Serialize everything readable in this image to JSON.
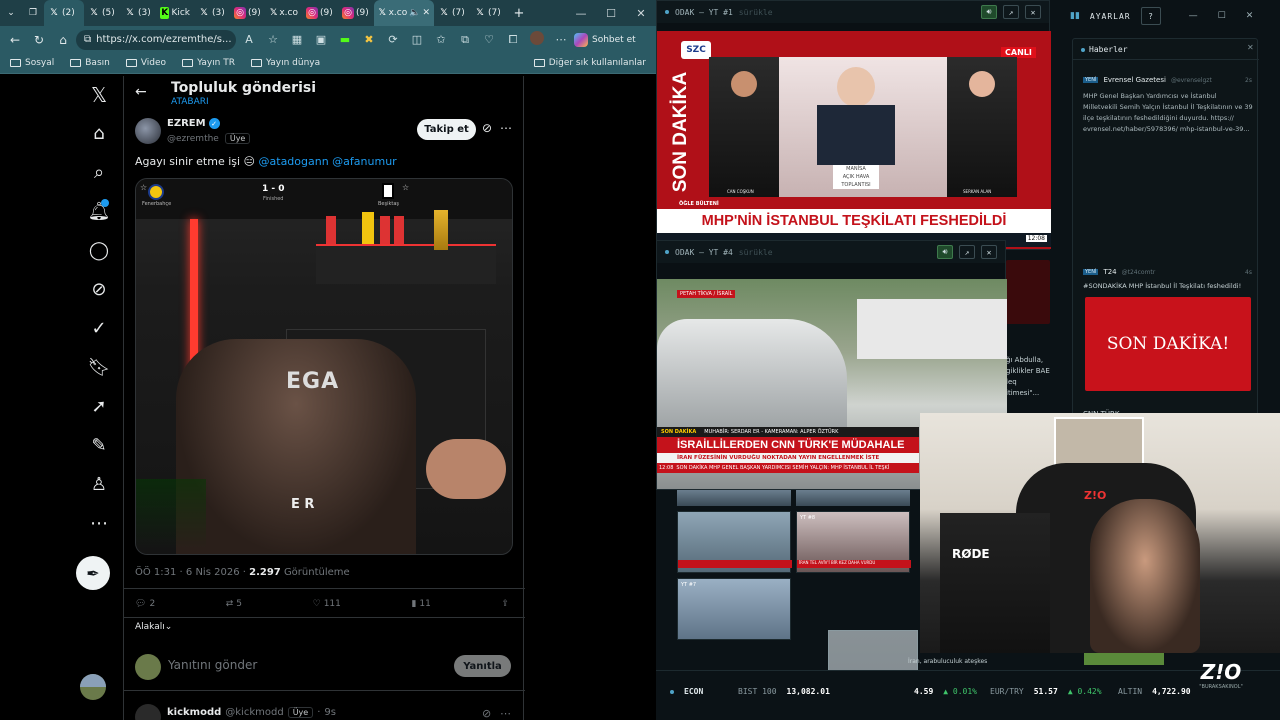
{
  "browser": {
    "tabs": [
      {
        "icon": "x",
        "label": "(2)"
      },
      {
        "icon": "x",
        "label": "(5)"
      },
      {
        "icon": "x",
        "label": "(3)"
      },
      {
        "icon": "kick",
        "label": "Kick"
      },
      {
        "icon": "x",
        "label": "(3)"
      },
      {
        "icon": "ig",
        "label": "(9)"
      },
      {
        "icon": "x",
        "label": "x.co"
      },
      {
        "icon": "ig",
        "label": "(9)"
      },
      {
        "icon": "ig",
        "label": "(9)"
      },
      {
        "icon": "x",
        "label": "x.co"
      },
      {
        "icon": "x",
        "label": "(7)"
      },
      {
        "icon": "x",
        "label": "(7)"
      }
    ],
    "url": "https://x.com/ezremthe/s...",
    "copilot_label": "Sohbet et",
    "bookmarks": [
      "Sosyal",
      "Basın",
      "Video",
      "Yayın TR",
      "Yayın dünya"
    ],
    "bookmarks_right": "Diğer sık kullanılanlar"
  },
  "x": {
    "page_title": "Topluluk gönderisi",
    "page_sub": "ATABARI",
    "author_name": "EZREM",
    "author_handle": "@ezremthe",
    "author_badge": "Üye",
    "follow_label": "Takip et",
    "tweet_text": "Agayı sinir etme işi 😑",
    "mentions": "@atadogann @afanumur",
    "time": "ÖÖ 1:31 · 6 Nis 2026 ·",
    "views_count": "2.297",
    "views_label": "Görüntüleme",
    "replies": "2",
    "reposts": "5",
    "likes": "111",
    "bookmarks": "11",
    "sort_label": "Alakalı",
    "reply_placeholder": "Yanıtını gönder",
    "reply_button": "Yanıtla",
    "next_reply_name": "kickmodd",
    "next_reply_handle": "@kickmodd",
    "next_reply_badge": "Üye",
    "next_reply_time": "9s",
    "media": {
      "score": "1 - 0",
      "score_sub": "Finished",
      "team1": "Fenerbahçe",
      "team2": "Beşiktaş",
      "shirt_text": "EGA",
      "logo_text": "E R"
    }
  },
  "dash": {
    "settings_label": "AYARLAR",
    "help_label": "?",
    "video1": {
      "title": "ODAK — YT #1",
      "sub": "sürükle",
      "channel": "SZC",
      "live": "CANLI",
      "banner_top": "SON DAKİKA",
      "bulletin": "ÖĞLE BÜLTENİ",
      "headline": "MHP'NİN İSTANBUL TEŞKİLATI FESHEDİLDİ",
      "time": "12:08",
      "name1": "CAN COŞKUN",
      "name2": "SERKAN ALAN",
      "podium": "MANİSA",
      "podium_sub": "AÇIK HAVA TOPLANTISI"
    },
    "video2": {
      "title": "ODAK — YT #4",
      "sub": "sürükle",
      "location": "PETAH TİKVA / İSRAİL",
      "tag": "SON DAKİKA",
      "credits": "MUHABİR: SERDAR ER - KAMERAMAN: ALPER ÖZTÜRK",
      "headline": "İSRAİLLİLERDEN CNN TÜRK'E MÜDAHALE",
      "sub_headline": "İRAN FÜZESİNİN VURDUĞU NOKTADAN YAYIN ENGELLENMEK İSTE",
      "ticker": "SON DAKİKA  MHP GENEL BAŞKAN YARDIMCISI SEMİH YALÇIN: MHP İSTANBUL İL TEŞKİ",
      "ticker_time": "12:08"
    },
    "thumbs": [
      {
        "label": "",
        "caption": ""
      },
      {
        "label": "YT #8",
        "caption": "İRAN TEL AVİV'İ BİR KEZ DAHA VURDU"
      },
      {
        "label": "YT #7",
        "caption": ""
      }
    ],
    "behind_text": [
      "ğı Abdulla,",
      "giklikler BAE",
      "leq",
      "itimesi\"..."
    ],
    "behind_caption": "İran, arabuluculuk ateşkes",
    "news_panel": {
      "title": "Haberler",
      "item1": {
        "badge": "YENİ",
        "source": "Evrensel Gazetesi",
        "handle": "@evrenselgzt",
        "age": "2s",
        "text": "MHP Genel Başkan Yardımcısı ve İstanbul Milletvekili Semih Yalçın İstanbul İl Teşkilatının ve 39 ilçe teşkilatının feshedildiğini duyurdu. https:// evrensel.net/haber/5978396/ mhp-istanbul-ve-39..."
      },
      "item2": {
        "badge": "YENİ",
        "source": "T24",
        "handle": "@t24comtr",
        "age": "4s",
        "text": "#SONDAKİKA MHP İstanbul İl Teşkilatı feshedildi!",
        "card": "SON DAKİKA!"
      },
      "item3": {
        "source": "CNN TÜRK"
      }
    },
    "ticker": {
      "econ": "ECON",
      "bist_label": "BIST 100",
      "bist": "13,082.01",
      "usd_value": "4.59",
      "usd_change": "▲ 0.01%",
      "eur_label": "EUR/TRY",
      "eur": "51.57",
      "eur_change": "▲ 0.42%",
      "gold_label": "ALTIN",
      "gold": "4,722.90"
    },
    "cam": {
      "brand": "RØDE",
      "chair": "Z!O",
      "watermark": "Z!O",
      "watermark_sub": "\"BURAKSAKINOL\""
    }
  }
}
